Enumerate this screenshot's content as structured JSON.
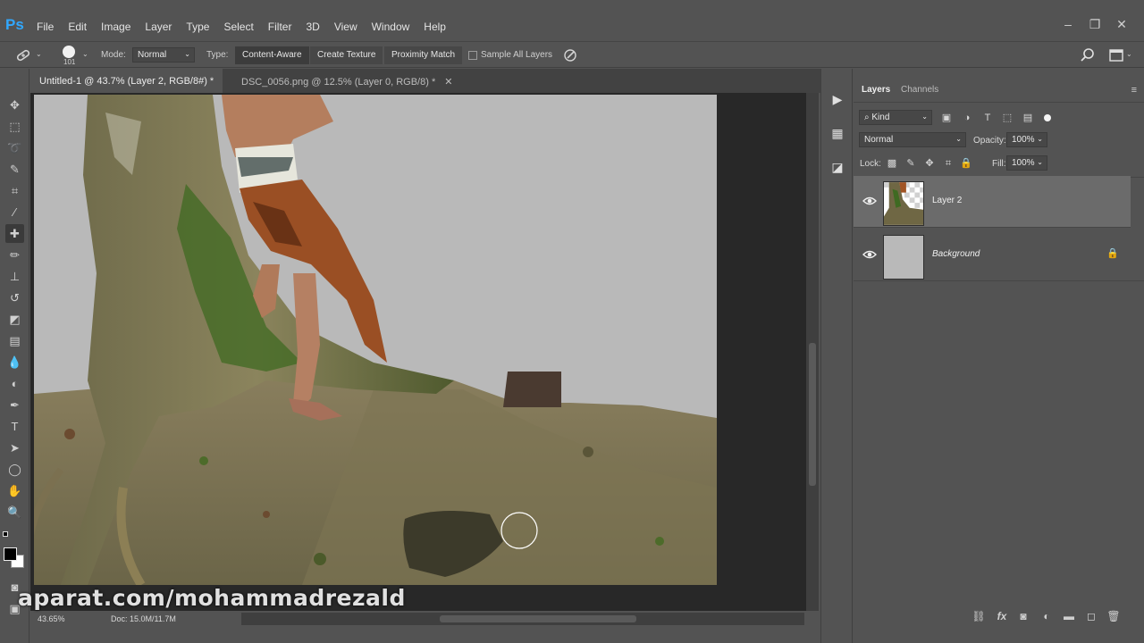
{
  "app": {
    "logo": "Ps"
  },
  "menu": [
    "File",
    "Edit",
    "Image",
    "Layer",
    "Type",
    "Select",
    "Filter",
    "3D",
    "View",
    "Window",
    "Help"
  ],
  "options": {
    "brush_size": "101",
    "mode_label": "Mode:",
    "mode_value": "Normal",
    "type_label": "Type:",
    "type_options": [
      "Content-Aware",
      "Create Texture",
      "Proximity Match"
    ],
    "type_selected": "Content-Aware",
    "sample_all_layers": "Sample All Layers"
  },
  "tabs": [
    {
      "label": "Untitled-1 @ 43.7% (Layer 2, RGB/8#) *",
      "active": true
    },
    {
      "label": "DSC_0056.png @ 12.5% (Layer 0, RGB/8) *",
      "active": false
    }
  ],
  "status": {
    "zoom": "43.65%",
    "doc": "Doc: 15.0M/11.7M"
  },
  "watermark": "aparat.com/mohammadrezald",
  "layers_panel": {
    "tabs": [
      "Layers",
      "Channels"
    ],
    "active_tab": "Layers",
    "filter_kind": "Kind",
    "blend_mode": "Normal",
    "opacity_label": "Opacity:",
    "opacity_value": "100%",
    "lock_label": "Lock:",
    "fill_label": "Fill:",
    "fill_value": "100%",
    "layers": [
      {
        "name": "Layer 2",
        "visible": true,
        "selected": true,
        "locked": false
      },
      {
        "name": "Background",
        "visible": true,
        "selected": false,
        "locked": true
      }
    ]
  },
  "colors": {
    "ui_bg": "#535353",
    "canvas_bg": "#282828",
    "document_bg": "#b9b9b9",
    "accent": "#31a8ff",
    "selected_layer": "#6b6b6b"
  }
}
